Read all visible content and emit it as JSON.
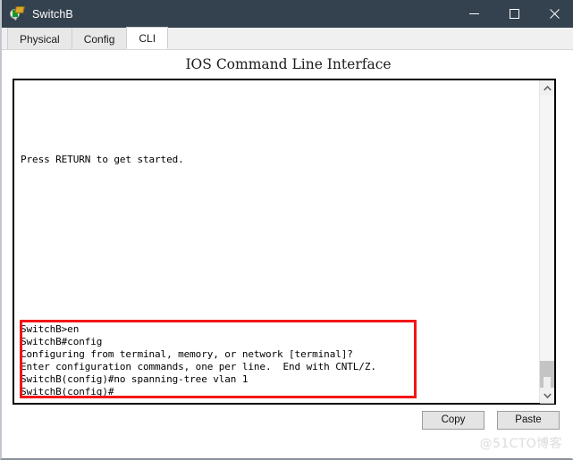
{
  "window": {
    "title": "SwitchB",
    "icon": "network-switch-magnifier-icon",
    "controls": {
      "minimize": "minimize-icon",
      "maximize": "maximize-icon",
      "close": "close-icon"
    },
    "titlebar_color": "#34414f"
  },
  "tabs": [
    {
      "label": "Physical",
      "active": false
    },
    {
      "label": "Config",
      "active": false
    },
    {
      "label": "CLI",
      "active": true
    }
  ],
  "main": {
    "heading": "IOS Command Line Interface"
  },
  "terminal": {
    "top_lines": [
      "Press RETURN to get started."
    ],
    "highlighted_lines": [
      "SwitchB>en",
      "SwitchB#config",
      "Configuring from terminal, memory, or network [terminal]?",
      "Enter configuration commands, one per line.  End with CNTL/Z.",
      "SwitchB(config)#no spanning-tree vlan 1",
      "SwitchB(config)#"
    ],
    "highlight_color": "#f21616"
  },
  "scrollbar": {
    "up_arrow": "chevron-up-icon",
    "down_arrow": "chevron-down-icon"
  },
  "footer": {
    "copy_label": "Copy",
    "paste_label": "Paste"
  },
  "watermark": {
    "text": "@51CTO博客"
  }
}
